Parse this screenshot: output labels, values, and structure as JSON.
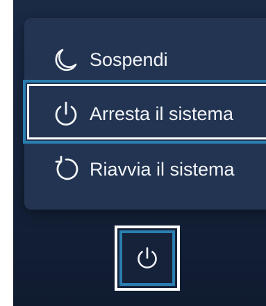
{
  "power_menu": {
    "items": [
      {
        "label": "Sospendi",
        "icon": "moon-icon"
      },
      {
        "label": "Arresta il sistema",
        "icon": "power-icon",
        "highlighted": true
      },
      {
        "label": "Riavvia il sistema",
        "icon": "restart-icon"
      }
    ]
  },
  "power_button": {
    "icon": "power-icon"
  },
  "colors": {
    "background": "#15223a",
    "menu": "#223451",
    "text": "#f2f4f8",
    "highlight_outer": "#2a7fb0",
    "highlight_inner": "#ffffff"
  }
}
